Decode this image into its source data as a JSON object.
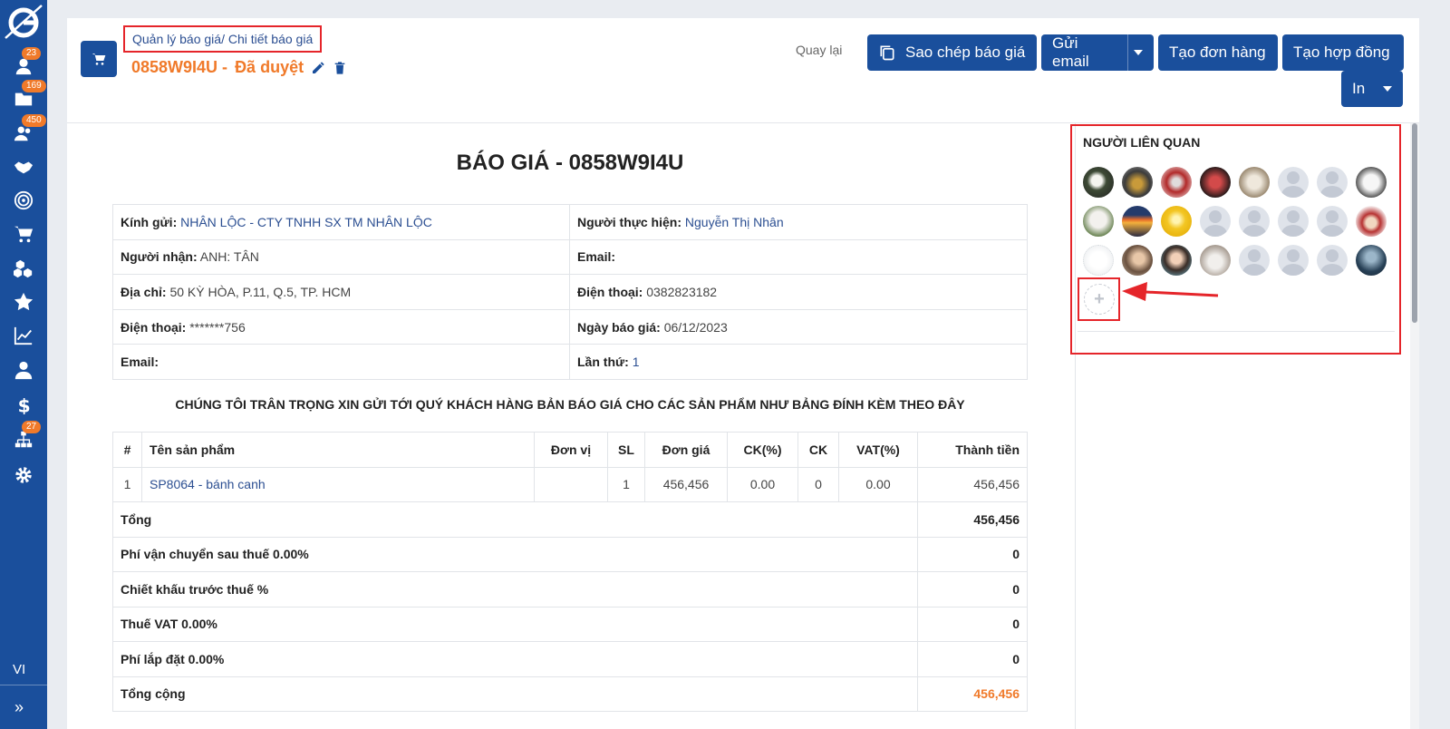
{
  "sidebar": {
    "badges": {
      "contacts": "23",
      "leads": "169",
      "customers": "450",
      "tasks": "27"
    },
    "language": "VI"
  },
  "header": {
    "breadcrumb": "Quản lý báo giá/ Chi tiết báo giá",
    "quote_code": "0858W9I4U -",
    "status": "Đã duyệt",
    "back_label": "Quay lại",
    "copy_label": "Sao chép báo giá",
    "email_label": "Gửi email",
    "order_label": "Tạo đơn hàng",
    "contract_label": "Tạo hợp đồng",
    "print_label": "In"
  },
  "document": {
    "title": "BÁO GIÁ - 0858W9I4U",
    "info": {
      "to_label": "Kính gửi:",
      "to_value": "NHÂN LỘC - CTY TNHH SX TM NHÂN LỘC",
      "performer_label": "Người thực hiện:",
      "performer_value": "Nguyễn Thị Nhân",
      "receiver_label": "Người nhận:",
      "receiver_value": "ANH: TÂN",
      "email_label": "Email:",
      "email_value": "",
      "address_label": "Địa chỉ:",
      "address_value": "50 KỲ HÒA, P.11, Q.5, TP. HCM",
      "phone_label": "Điện thoại:",
      "phone_value": "0382823182",
      "phone2_label": "Điện thoại:",
      "phone2_value": "*******756",
      "date_label": "Ngày báo giá:",
      "date_value": "06/12/2023",
      "email2_label": "Email:",
      "email2_value": "",
      "times_label": "Lần thứ:",
      "times_value": "1"
    },
    "intro": "CHÚNG TÔI TRÂN TRỌNG XIN GỬI TỚI QUÝ KHÁCH HÀNG BẢN BÁO GIÁ CHO CÁC SẢN PHẨM NHƯ BẢNG ĐÍNH KÈM THEO ĐÂY",
    "columns": [
      "#",
      "Tên sản phẩm",
      "Đơn vị",
      "SL",
      "Đơn giá",
      "CK(%)",
      "CK",
      "VAT(%)",
      "Thành tiền"
    ],
    "rows": [
      {
        "no": "1",
        "name": "SP8064 - bánh canh",
        "unit": "",
        "qty": "1",
        "price": "456,456",
        "ck_pct": "0.00",
        "ck": "0",
        "vat": "0.00",
        "total": "456,456"
      }
    ],
    "summary": [
      {
        "label": "Tổng",
        "value": "456,456"
      },
      {
        "label": "Phí vận chuyển sau thuế 0.00%",
        "value": "0"
      },
      {
        "label": "Chiết khấu trước thuế %",
        "value": "0"
      },
      {
        "label": "Thuế VAT 0.00%",
        "value": "0"
      },
      {
        "label": "Phí lắp đặt 0.00%",
        "value": "0"
      },
      {
        "label": "Tổng cộng",
        "value": "456,456"
      }
    ]
  },
  "people": {
    "title": "NGƯỜI LIÊN QUAN",
    "add_symbol": "+"
  },
  "colors": {
    "primary": "#1a4f9c",
    "accent": "#f07a2a",
    "highlight": "#e5252a"
  }
}
